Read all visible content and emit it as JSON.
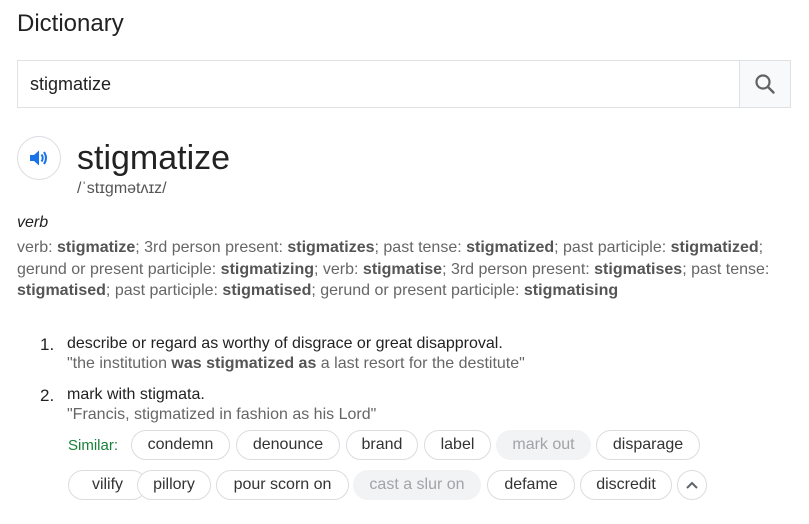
{
  "title": "Dictionary",
  "search": {
    "value": "stigmatize"
  },
  "entry": {
    "word": "stigmatize",
    "phonetic": "/ˈstɪɡmətʌɪz/",
    "part_of_speech": "verb",
    "forms": [
      {
        "label": "verb:",
        "value": "stigmatize"
      },
      {
        "label": "3rd person present:",
        "value": "stigmatizes"
      },
      {
        "label": "past tense:",
        "value": "stigmatized"
      },
      {
        "label": "past participle:",
        "value": "stigmatized"
      },
      {
        "label": "gerund or present participle:",
        "value": "stigmatizing"
      },
      {
        "label": "verb:",
        "value": "stigmatise"
      },
      {
        "label": "3rd person present:",
        "value": "stigmatises"
      },
      {
        "label": "past tense:",
        "value": "stigmatised"
      },
      {
        "label": "past participle:",
        "value": "stigmatised"
      },
      {
        "label": "gerund or present participle:",
        "value": "stigmatising"
      }
    ],
    "definitions": [
      {
        "number": "1.",
        "text": "describe or regard as worthy of disgrace or great disapproval.",
        "example_pre": "\"the institution ",
        "example_bold": "was stigmatized as",
        "example_post": " a last resort for the destitute\""
      },
      {
        "number": "2.",
        "text": "mark with stigmata.",
        "example_pre": "\"Francis, stigmatized in fashion as his Lord\"",
        "example_bold": "",
        "example_post": ""
      }
    ],
    "similar_label": "Similar:",
    "similar": [
      {
        "word": "condemn",
        "disabled": false
      },
      {
        "word": "denounce",
        "disabled": false
      },
      {
        "word": "brand",
        "disabled": false
      },
      {
        "word": "label",
        "disabled": false
      },
      {
        "word": "mark out",
        "disabled": true
      },
      {
        "word": "disparage",
        "disabled": false
      },
      {
        "word": "vilify",
        "disabled": false
      },
      {
        "word": "pillory",
        "disabled": false
      },
      {
        "word": "pour scorn on",
        "disabled": false
      },
      {
        "word": "cast a slur on",
        "disabled": true
      },
      {
        "word": "defame",
        "disabled": false
      },
      {
        "word": "discredit",
        "disabled": false
      }
    ]
  },
  "colors": {
    "speaker_blue": "#1a73e8",
    "similar_green": "#188038"
  },
  "icons": {
    "search": "search-icon",
    "speaker": "speaker-icon",
    "collapse": "chevron-up-icon"
  }
}
